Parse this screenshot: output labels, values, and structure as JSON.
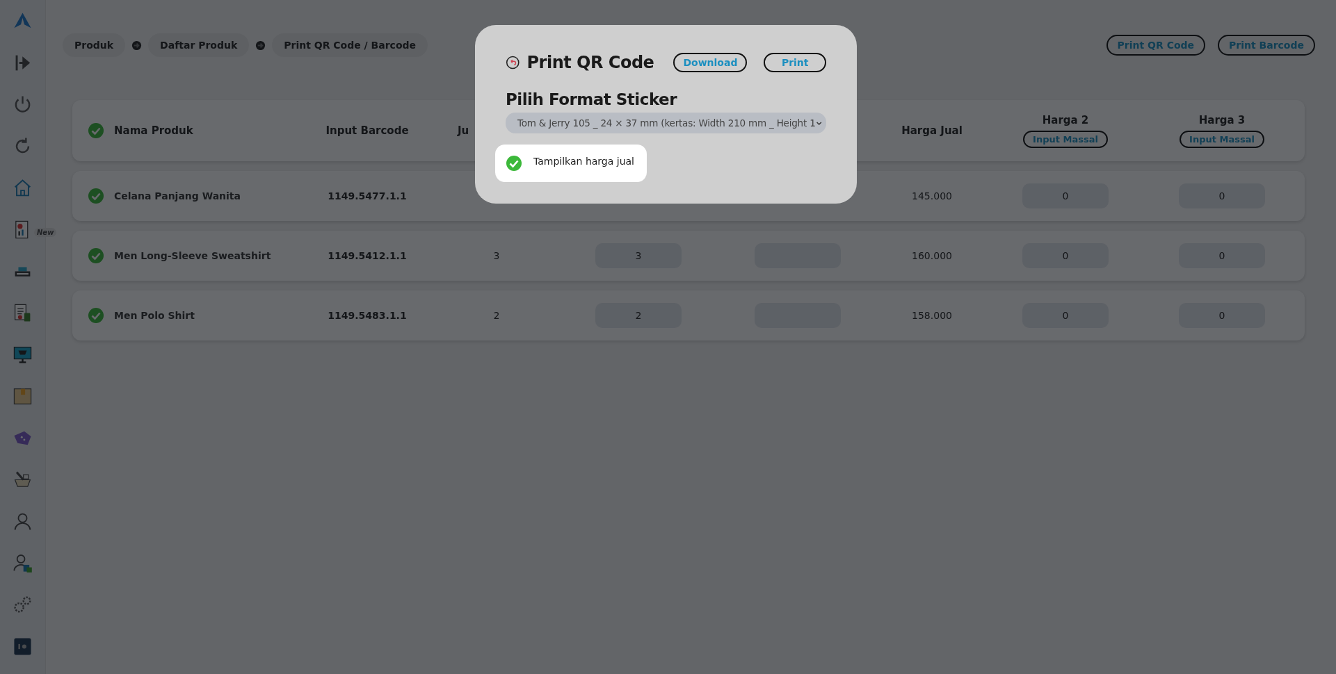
{
  "sidebar": {
    "new_badge": "New"
  },
  "breadcrumbs": [
    {
      "label": "Produk"
    },
    {
      "label": "Daftar Produk"
    },
    {
      "label": "Print QR Code / Barcode"
    }
  ],
  "top_actions": [
    "Print QR Code",
    "Print Barcode"
  ],
  "table": {
    "all_checked": true,
    "columns": [
      {
        "label": "Nama Produk"
      },
      {
        "label": "Input Barcode"
      },
      {
        "label": "Ju"
      },
      {},
      {},
      {
        "label": "Harga Jual"
      },
      {
        "label": "Harga 2",
        "action": "Input Massal"
      },
      {
        "label": "Harga 3",
        "action": "Input Massal"
      }
    ],
    "rows": [
      {
        "checked": true,
        "name": "Celana Panjang Wanita",
        "barcode": "1149.5477.1.1",
        "harga_jual": "145.000",
        "harga_2": "0",
        "harga_3": "0"
      },
      {
        "checked": true,
        "name": "Men Long-Sleeve Sweatshirt",
        "barcode": "1149.5412.1.1",
        "column_3": "3",
        "column_4": "3",
        "column_5": "",
        "harga_jual": "160.000",
        "harga_2": "0",
        "harga_3": "0"
      },
      {
        "checked": true,
        "name": "Men Polo Shirt",
        "barcode": "1149.5483.1.1",
        "column_3": "2",
        "column_4": "2",
        "column_5": "",
        "harga_jual": "158.000",
        "harga_2": "0",
        "harga_3": "0"
      }
    ]
  },
  "modal": {
    "title": "Print QR Code",
    "buttons": [
      "Download",
      "Print"
    ],
    "section_title": "Pilih Format Sticker",
    "format_select": {
      "value": "Tom & Jerry 105 _ 24 × 37 mm (kertas: Width 210 mm _ Height 1"
    },
    "show_price": {
      "label": "Tampilkan harga jual",
      "checked": true
    }
  }
}
